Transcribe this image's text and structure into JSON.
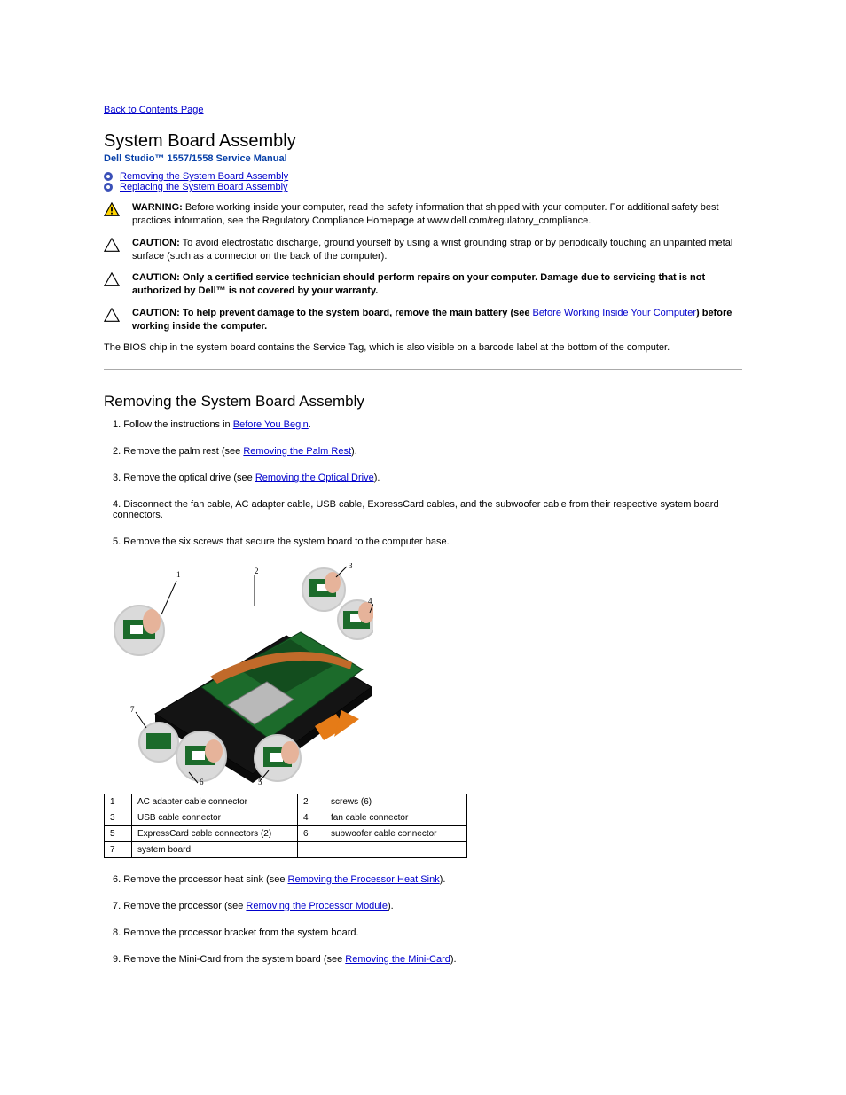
{
  "nav": {
    "back": "Back to Contents Page"
  },
  "heading": {
    "title": "System Board Assembly",
    "manual": "Dell Studio™ 1557/1558 Service Manual"
  },
  "toc": {
    "item1": "Removing the System Board Assembly",
    "item2": "Replacing the System Board Assembly"
  },
  "warnings": {
    "warn1_lead": "WARNING:",
    "warn1": "Before working inside your computer, read the safety information that shipped with your computer. For additional safety best practices information, see the Regulatory Compliance Homepage at www.dell.com/regulatory_compliance.",
    "caution1_lead": "CAUTION:",
    "caution1": "To avoid electrostatic discharge, ground yourself by using a wrist grounding strap or by periodically touching an unpainted metal surface (such as a connector on the back of the computer).",
    "caution2_lead": "CAUTION:",
    "caution2a": "Only a certified service technician should perform repairs on your computer. Damage due to servicing that is not authorized by Dell™",
    "caution2b": "is not covered by your warranty.",
    "caution3_lead": "CAUTION:",
    "caution3a": "To help prevent damage to the system board, remove the main battery (see ",
    "caution3_link": "Before Working Inside Your Computer",
    "caution3b": ") before working inside the computer."
  },
  "section1": {
    "heading": "Removing the System Board Assembly",
    "intro": "The BIOS chip in the system board contains the Service Tag, which is also visible on a barcode label at the bottom of the computer.",
    "step1a": "Follow the instructions in ",
    "step1_link": "Before You Begin",
    "step1b": ".",
    "step2a": "Remove the palm rest (see ",
    "step2_link": "Removing the Palm Rest",
    "step2b": ").",
    "step3a": "Remove the optical drive (see ",
    "step3_link": "Removing the Optical Drive",
    "step3b": ").",
    "step4": "Disconnect the fan cable, AC adapter cable, USB cable, ExpressCard cables, and the subwoofer cable from their respective system board connectors.",
    "step5": "Remove the six screws that secure the system board to the computer base.",
    "step6a": "Remove the processor heat sink (see ",
    "step6_link": "Removing the Processor Heat Sink",
    "step6b": ").",
    "step7a": "Remove the processor (see ",
    "step7_link": "Removing the Processor Module",
    "step7b": ").",
    "step8a": "Remove the processor bracket from the system board.",
    "step8b": "Remove the Mini-Card from the system board (see ",
    "step8_link": "Removing the Mini-Card",
    "step8c": ")."
  },
  "table": {
    "r1c1": "1",
    "r1c2": "AC adapter cable connector",
    "r1c3": "2",
    "r1c4": "screws (6)",
    "r2c1": "3",
    "r2c2": "USB cable connector",
    "r2c3": "4",
    "r2c4": "fan cable connector",
    "r3c1": "5",
    "r3c2": "ExpressCard cable connectors (2)",
    "r3c3": "6",
    "r3c4": "subwoofer cable connector",
    "r4c1": "7",
    "r4c2": "system board"
  }
}
